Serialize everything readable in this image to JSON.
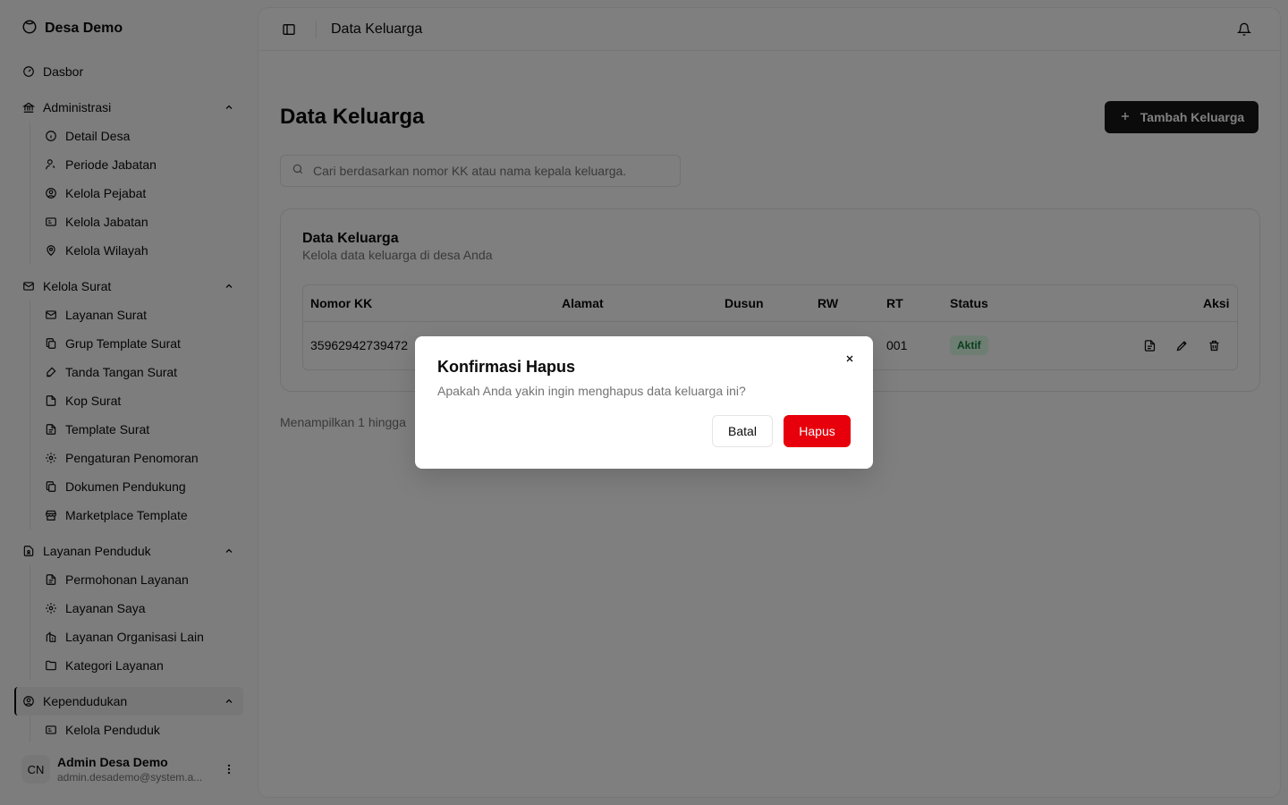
{
  "sidebar": {
    "brand": "Desa Demo",
    "dashboard": "Dasbor",
    "groups": [
      {
        "label": "Administrasi",
        "items": [
          "Detail Desa",
          "Periode Jabatan",
          "Kelola Pejabat",
          "Kelola Jabatan",
          "Kelola Wilayah"
        ]
      },
      {
        "label": "Kelola Surat",
        "items": [
          "Layanan Surat",
          "Grup Template Surat",
          "Tanda Tangan Surat",
          "Kop Surat",
          "Template Surat",
          "Pengaturan Penomoran",
          "Dokumen Pendukung",
          "Marketplace Template"
        ]
      },
      {
        "label": "Layanan Penduduk",
        "items": [
          "Permohonan Layanan",
          "Layanan Saya",
          "Layanan Organisasi Lain",
          "Kategori Layanan"
        ]
      },
      {
        "label": "Kependudukan",
        "items": [
          "Kelola Penduduk"
        ]
      }
    ],
    "user": {
      "initials": "CN",
      "name": "Admin Desa Demo",
      "email": "admin.desademo@system.a..."
    }
  },
  "header": {
    "breadcrumb": "Data Keluarga"
  },
  "main": {
    "title": "Data Keluarga",
    "add_button": "Tambah Keluarga",
    "search_placeholder": "Cari berdasarkan nomor KK atau nama kepala keluarga.",
    "card": {
      "title": "Data Keluarga",
      "description": "Kelola data keluarga di desa Anda",
      "columns": [
        "Nomor KK",
        "Alamat",
        "Dusun",
        "RW",
        "RT",
        "Status",
        "Aksi"
      ],
      "rows": [
        {
          "nomor_kk": "35962942739472",
          "rt": "001",
          "status": "Aktif"
        }
      ]
    },
    "footer": "Menampilkan 1 hingga"
  },
  "dialog": {
    "title": "Konfirmasi Hapus",
    "description": "Apakah Anda yakin ingin menghapus data keluarga ini?",
    "cancel": "Batal",
    "confirm": "Hapus"
  },
  "colors": {
    "danger": "#e7000b",
    "primary": "#171717",
    "status_active_bg": "#dcfce7",
    "status_active_text": "#15803d"
  }
}
